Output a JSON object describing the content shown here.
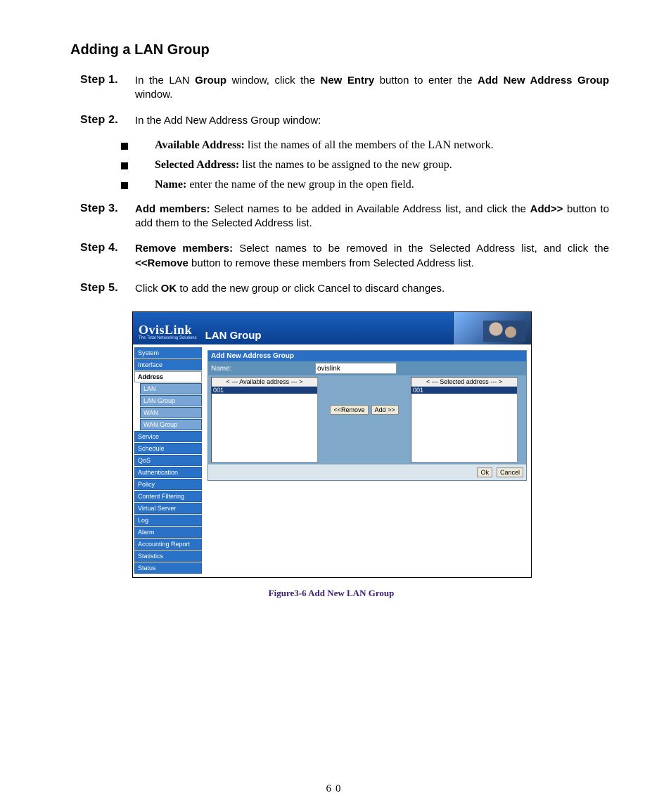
{
  "title": "Adding a LAN Group",
  "steps": {
    "s1": {
      "label": "Step 1.",
      "pre": "In the LAN ",
      "b1": "Group",
      "mid1": " window, click the ",
      "b2": "New Entry",
      "mid2": " button to enter the ",
      "b3": "Add New Address Group",
      "post": " window."
    },
    "s2": {
      "label": "Step 2.",
      "text": "In the Add New Address Group window:"
    },
    "bullets": {
      "b1": {
        "bold": "Available Address:",
        "rest": " list the names of all the members of the LAN network."
      },
      "b2": {
        "bold": "Selected Address:",
        "rest": " list the names to be assigned to the new group."
      },
      "b3": {
        "bold": "Name:",
        "rest": " enter the name of the new group in the open field."
      }
    },
    "s3": {
      "label": "Step 3.",
      "b1": "Add members:",
      "mid1": " Select names to be added in Available Address list, and click the ",
      "b2": "Add>>",
      "post": " button to add them to the Selected Address list."
    },
    "s4": {
      "label": "Step 4.",
      "b1": "Remove members:",
      "mid1": " Select names to be removed in the Selected Address list, and click the ",
      "b2": "<<Remove",
      "post": " button to remove these members from Selected Address list."
    },
    "s5": {
      "label": "Step 5.",
      "pre": "Click ",
      "b1": "OK",
      "post": " to add the new group or click Cancel to discard changes."
    }
  },
  "shot": {
    "brand": "OvisLink",
    "tagline": "The Total Networking Solutions",
    "header_title": "LAN Group",
    "nav": {
      "system": "System",
      "interface": "Interface",
      "address": "Address",
      "lan": "LAN",
      "lan_group": "LAN Group",
      "wan": "WAN",
      "wan_group": "WAN Group",
      "service": "Service",
      "schedule": "Schedule",
      "qos": "QoS",
      "auth": "Authentication",
      "policy": "Policy",
      "cf": "Content Filtering",
      "vs": "Virtual Server",
      "log": "Log",
      "alarm": "Alarm",
      "acct": "Accounting Report",
      "stats": "Statistics",
      "status": "Status"
    },
    "panel": {
      "title": "Add New Address Group",
      "name_label": "Name:",
      "name_value": "ovislink",
      "available_header": "< --- Available address --- >",
      "available_item": "001",
      "selected_header": "< --- Selected address --- >",
      "selected_item": "001",
      "btn_remove": "<<Remove",
      "btn_add": "Add >>",
      "btn_ok": "Ok",
      "btn_cancel": "Cancel"
    }
  },
  "caption": "Figure3-6 Add New LAN Group",
  "page_number": "60"
}
